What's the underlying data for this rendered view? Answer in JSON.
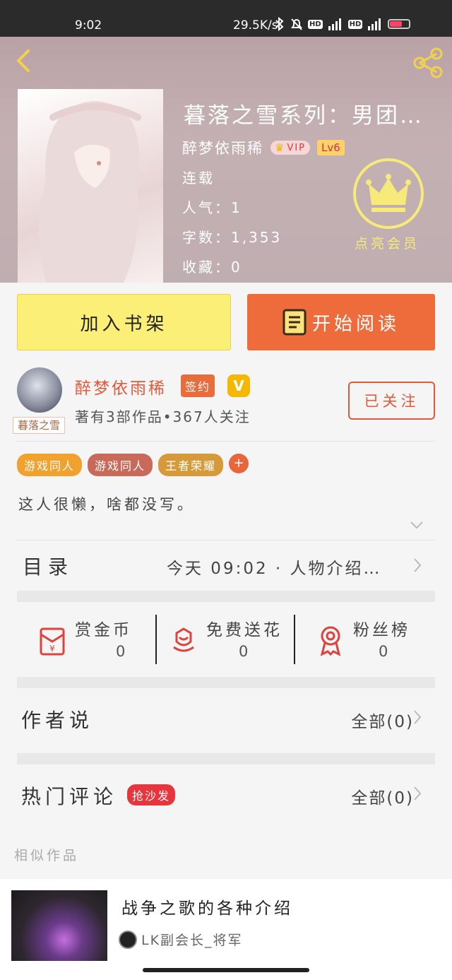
{
  "status_bar": {
    "time": "9:02",
    "network_speed": "29.5K/s",
    "battery_level": "40"
  },
  "book": {
    "title": "暮落之雪系列：男团…",
    "author": "醉梦依雨稀",
    "vip_label": "VIP",
    "level": "Lv6",
    "status": "连载",
    "popularity": "人气：1",
    "word_count": "字数：1,353",
    "favorites": "收藏：0"
  },
  "member": {
    "label": "点亮会员",
    "icon": "crown-icon"
  },
  "actions": {
    "add_shelf": "加入书架",
    "start_read": "开始阅读"
  },
  "author_card": {
    "name": "醉梦依雨稀",
    "sign_badge": "签约",
    "v_badge": "V",
    "avatar_tag": "暮落之雪",
    "stats": "著有3部作品•367人关注",
    "follow_label": "已关注"
  },
  "tags": [
    {
      "label": "游戏同人",
      "color": "#f0a12e"
    },
    {
      "label": "游戏同人",
      "color": "#c86a5a"
    },
    {
      "label": "王者荣耀",
      "color": "#d79a3a"
    }
  ],
  "tag_add": "+",
  "bio": "这人很懒，啥都没写。",
  "toc": {
    "label": "目录",
    "latest": "今天 09:02 · 人物介绍…"
  },
  "gifts": [
    {
      "label": "赏金币",
      "value": "0",
      "icon": "red-envelope-icon"
    },
    {
      "label": "免费送花",
      "value": "0",
      "icon": "flower-icon"
    },
    {
      "label": "粉丝榜",
      "value": "0",
      "icon": "ribbon-medal-icon"
    }
  ],
  "author_says": {
    "label": "作者说",
    "all": "全部(0)"
  },
  "hot_comments": {
    "label": "热门评论",
    "badge": "抢沙发",
    "all": "全部(0)"
  },
  "similar": {
    "section_label": "相似作品",
    "items": [
      {
        "title": "战争之歌的各种介绍",
        "author": "LK副会长_将军"
      }
    ]
  },
  "colors": {
    "accent": "#ee6b3b",
    "shelf_yellow": "#fbef78",
    "member_gold": "#f7ea7a",
    "author_red": "#e05a3a"
  }
}
